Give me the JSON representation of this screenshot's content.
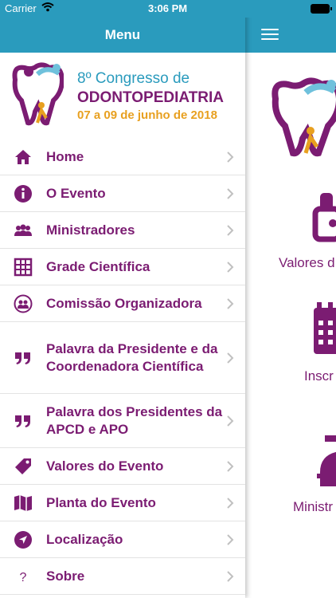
{
  "status": {
    "carrier": "Carrier",
    "time": "3:06 PM"
  },
  "menu": {
    "title": "Menu",
    "brand": {
      "line1": "8º Congresso de",
      "line2": "ODONTOPEDIATRIA",
      "line3": "07 a 09 de junho de 2018"
    },
    "items": [
      {
        "label": "Home",
        "icon": "home-icon"
      },
      {
        "label": "O Evento",
        "icon": "info-icon"
      },
      {
        "label": "Ministradores",
        "icon": "people-icon"
      },
      {
        "label": "Grade Científica",
        "icon": "grid-icon"
      },
      {
        "label": "Comissão Organizadora",
        "icon": "group-circle-icon"
      },
      {
        "label": "Palavra da Presidente e da Coordenadora Científica",
        "icon": "quote-icon"
      },
      {
        "label": "Palavra dos Presidentes da APCD e APO",
        "icon": "quote-icon"
      },
      {
        "label": "Valores do Evento",
        "icon": "price-tag-icon"
      },
      {
        "label": "Planta do Evento",
        "icon": "map-icon"
      },
      {
        "label": "Localização",
        "icon": "location-arrow-icon"
      },
      {
        "label": "Sobre",
        "icon": "question-icon"
      }
    ]
  },
  "background": {
    "tiles": [
      {
        "label": "Valores d",
        "icon": "price-tag-icon"
      },
      {
        "label": "Inscr",
        "icon": "calendar-icon"
      },
      {
        "label": "Ministr",
        "icon": "person-icon"
      }
    ]
  },
  "colors": {
    "header": "#2a9bbd",
    "accent": "#7b1c72",
    "gold": "#e8a020"
  }
}
